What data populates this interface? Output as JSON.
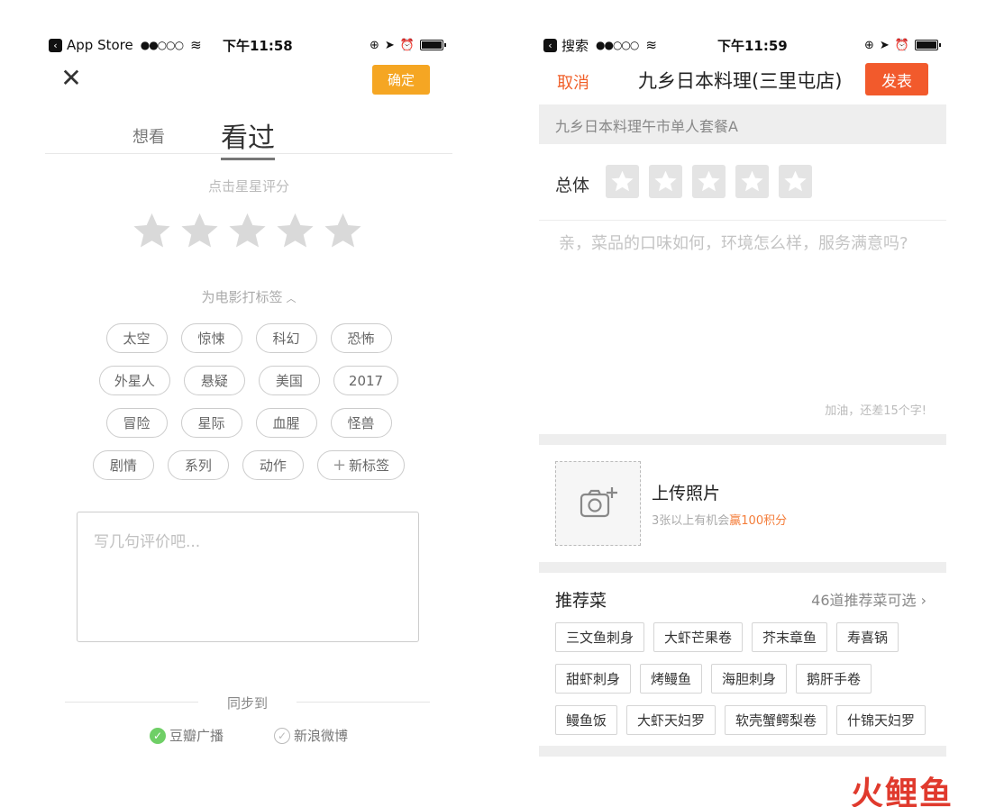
{
  "left": {
    "status": {
      "back_app": "App Store",
      "signal": "●●○○○",
      "time": "下午11:58"
    },
    "confirm": "确定",
    "tabs": {
      "want": "想看",
      "seen": "看过"
    },
    "rate_hint": "点击星星评分",
    "tag_title": "为电影打标签",
    "tags": [
      [
        "太空",
        "惊悚",
        "科幻",
        "恐怖"
      ],
      [
        "外星人",
        "悬疑",
        "美国",
        "2017"
      ],
      [
        "冒险",
        "星际",
        "血腥",
        "怪兽"
      ],
      [
        "剧情",
        "系列",
        "动作"
      ]
    ],
    "new_tag": "新标签",
    "review_placeholder": "写几句评价吧...",
    "sync_label": "同步到",
    "sync_douban": "豆瓣广播",
    "sync_weibo": "新浪微博"
  },
  "right": {
    "status": {
      "back_app": "搜索",
      "signal": "●●○○○",
      "time": "下午11:59"
    },
    "cancel": "取消",
    "title": "九乡日本料理(三里屯店)",
    "publish": "发表",
    "subtitle": "九乡日本料理午市单人套餐A",
    "overall_label": "总体",
    "comment_placeholder": "亲，菜品的口味如何，环境怎么样，服务满意吗?",
    "counter": "加油，还差15个字!",
    "upload_title": "上传照片",
    "upload_tip_prefix": "3张以上有机会",
    "upload_tip_highlight": "赢100积分",
    "rec_title": "推荐菜",
    "rec_more": "46道推荐菜可选",
    "dishes": [
      [
        "三文鱼刺身",
        "大虾芒果卷",
        "芥末章鱼",
        "寿喜锅"
      ],
      [
        "甜虾刺身",
        "烤鳗鱼",
        "海胆刺身",
        "鹅肝手卷"
      ],
      [
        "鳗鱼饭",
        "大虾天妇罗",
        "软壳蟹鳄梨卷",
        "什锦天妇罗"
      ]
    ]
  },
  "watermark": "火鲤鱼",
  "colors": {
    "confirm_orange": "#f5a623",
    "publish_red": "#f25a2c",
    "cancel_red": "#f0602a",
    "check_green": "#6fcf66"
  },
  "icons": [
    "close-icon",
    "star-icon",
    "chevron-up-icon",
    "plus-icon",
    "check-icon",
    "camera-plus-icon",
    "chevron-right-icon",
    "wifi-icon",
    "battery-icon",
    "alarm-icon",
    "location-icon"
  ]
}
